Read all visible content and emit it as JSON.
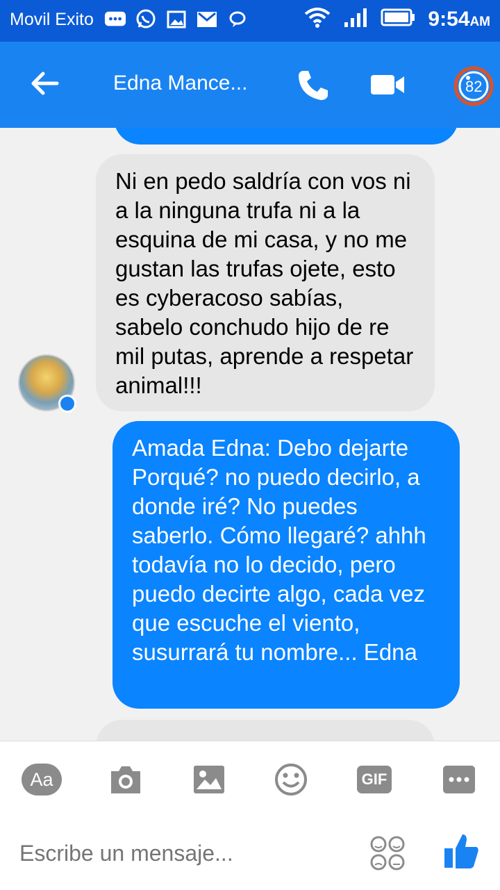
{
  "status_bar": {
    "carrier": "Movil Exito",
    "time": "9:54",
    "ampm": "AM"
  },
  "header": {
    "contact_name": "Edna Mance...",
    "badge_count": "82"
  },
  "messages": [
    {
      "direction": "incoming",
      "text": "Ni en pedo saldría con vos ni a la ninguna trufa ni a la esquina de mi casa, y no me gustan las trufas ojete, esto es cyberacoso sabías, sabelo conchudo hijo de re mil putas, aprende a respetar animal!!!"
    },
    {
      "direction": "outgoing",
      "text": "Amada Edna: Debo dejarte Porqué? no puedo decirlo, a donde iré? No puedes saberlo. Cómo llegaré? ahhh todavía no lo decido, pero puedo decirte algo, cada vez que escuche el viento, susurrará tu nombre... Edna"
    }
  ],
  "composer": {
    "placeholder": "Escribe un mensaje...",
    "text_button": "Aa",
    "gif_button": "GIF"
  },
  "colors": {
    "status_bar": "#0b5bd6",
    "header": "#1a83f2",
    "outgoing_bubble": "#0a84ff",
    "incoming_bubble": "#e6e6e6"
  }
}
